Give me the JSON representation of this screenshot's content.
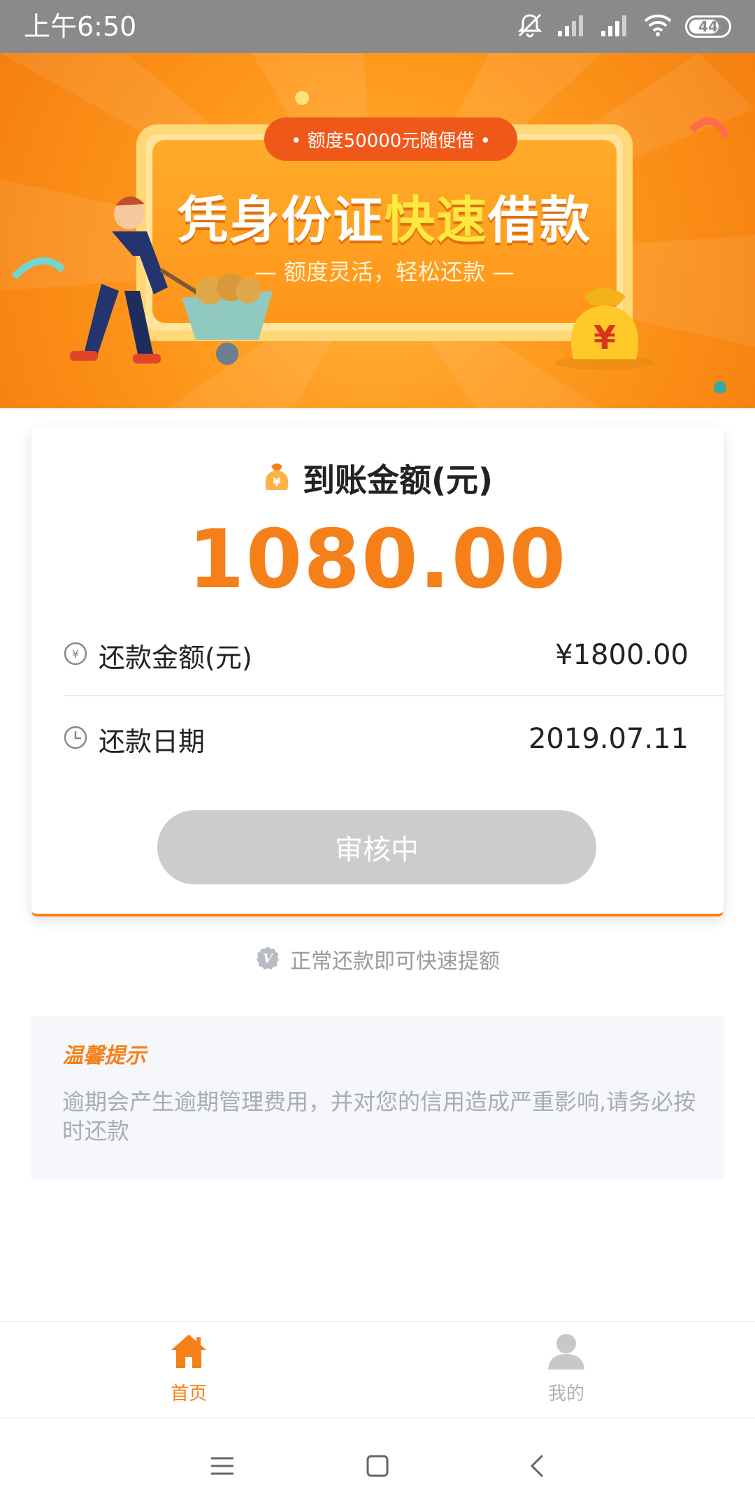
{
  "status_bar": {
    "time": "上午6:50",
    "battery": "44"
  },
  "banner": {
    "tag": "• 额度50000元随便借 •",
    "headline_part1": "凭身份证",
    "headline_highlight": "快速",
    "headline_part2": "借款",
    "subline": "— 额度灵活，轻松还款 —"
  },
  "card": {
    "title": "到账金额(元)",
    "amount": "1080.00",
    "repay_amount_label": "还款金额(元)",
    "repay_amount_value": "¥1800.00",
    "repay_date_label": "还款日期",
    "repay_date_value": "2019.07.11",
    "status_button": "审核中"
  },
  "tip": {
    "text": "正常还款即可快速提额"
  },
  "notice": {
    "heading": "温馨提示",
    "body": "逾期会产生逾期管理费用，并对您的信用造成严重影响,请务必按时还款"
  },
  "tabbar": {
    "home_label": "首页",
    "mine_label": "我的"
  },
  "colors": {
    "accent": "#f5801a",
    "status_bar": "#8a8a8a",
    "button_disabled": "#cccccc",
    "notice_bg": "#f5f7fa"
  }
}
